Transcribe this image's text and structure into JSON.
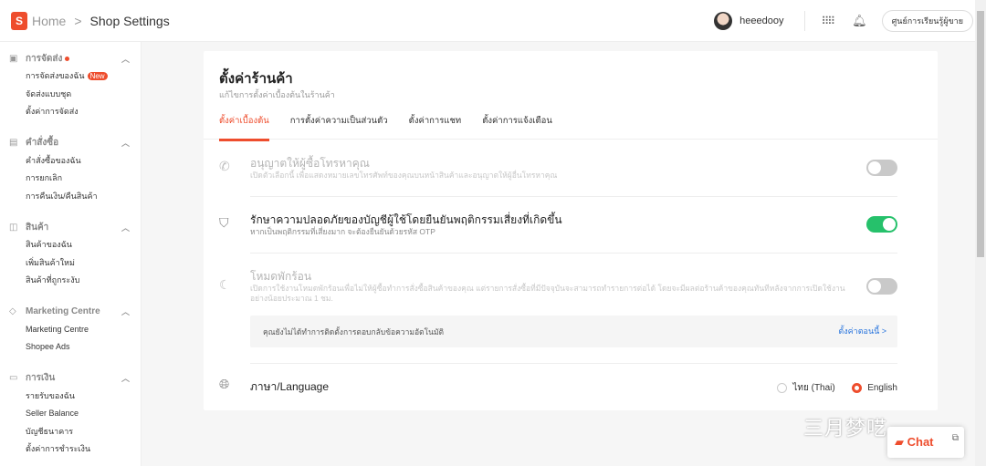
{
  "header": {
    "breadcrumb_home": "Home",
    "breadcrumb_sep": ">",
    "breadcrumb_page": "Shop Settings",
    "username": "heeedooy",
    "learning_center": "ศูนย์การเรียนรู้ผู้ขาย"
  },
  "sidebar": [
    {
      "title": "การจัดส่ง",
      "items": [
        "การจัดส่งของฉัน",
        "จัดส่งแบบชุด",
        "ตั้งค่าการจัดส่ง"
      ],
      "badge": "New"
    },
    {
      "title": "คำสั่งซื้อ",
      "items": [
        "คำสั่งซื้อของฉัน",
        "การยกเลิก",
        "การคืนเงิน/คืนสินค้า"
      ]
    },
    {
      "title": "สินค้า",
      "items": [
        "สินค้าของฉัน",
        "เพิ่มสินค้าใหม่",
        "สินค้าที่ถูกระงับ"
      ]
    },
    {
      "title": "Marketing Centre",
      "items": [
        "Marketing Centre",
        "Shopee Ads"
      ]
    },
    {
      "title": "การเงิน",
      "items": [
        "รายรับของฉัน",
        "Seller Balance",
        "บัญชีธนาคาร",
        "ตั้งค่าการชำระเงิน"
      ]
    }
  ],
  "main": {
    "title": "ตั้งค่าร้านค้า",
    "subtitle": "แก้ไขการตั้งค่าเบื้องต้นในร้านค้า",
    "tabs": [
      "ตั้งค่าเบื้องต้น",
      "การตั้งค่าความเป็นส่วนตัว",
      "ตั้งค่าการแชท",
      "ตั้งค่าการแจ้งเตือน"
    ],
    "settings": [
      {
        "title": "อนุญาตให้ผู้ซื้อโทรหาคุณ",
        "desc": "เปิดตัวเลือกนี้ เพื่อแสดงหมายเลขโทรศัพท์ของคุณบนหน้าสินค้าและอนุญาตให้ผู้อื่นโทรหาคุณ",
        "enabled": false
      },
      {
        "title": "รักษาความปลอดภัยของบัญชีผู้ใช้โดยยืนยันพฤติกรรมเสี่ยงที่เกิดขึ้น",
        "desc": "หากเป็นพฤติกรรมที่เสี่ยงมาก จะต้องยืนยันด้วยรหัส OTP",
        "enabled": true
      },
      {
        "title": "โหมดพักร้อน",
        "desc": "เปิดการใช้งานโหมดพักร้อนเพื่อไม่ให้ผู้ซื้อทำการสั่งซื้อสินค้าของคุณ แต่รายการสั่งซื้อที่มีปัจจุบันจะสามารถทำรายการต่อได้ โดยจะมีผลต่อร้านค้าของคุณทันทีหลังจากการเปิดใช้งานอย่างน้อยประมาณ 1 ชม.",
        "enabled": false
      }
    ],
    "notice": {
      "text": "คุณยังไม่ได้ทำการติดตั้งการตอบกลับข้อความอัตโนมัติ",
      "link": "ตั้งค่าตอนนี้ >"
    },
    "language": {
      "label": "ภาษา/Language",
      "options": [
        "ไทย (Thai)",
        "English"
      ],
      "selected": "English"
    }
  },
  "watermark": "三月梦呓",
  "chat": {
    "label": "Chat"
  },
  "colors": {
    "accent": "#ee4d2d",
    "toggle_on": "#26c16b",
    "link": "#2673dd"
  }
}
